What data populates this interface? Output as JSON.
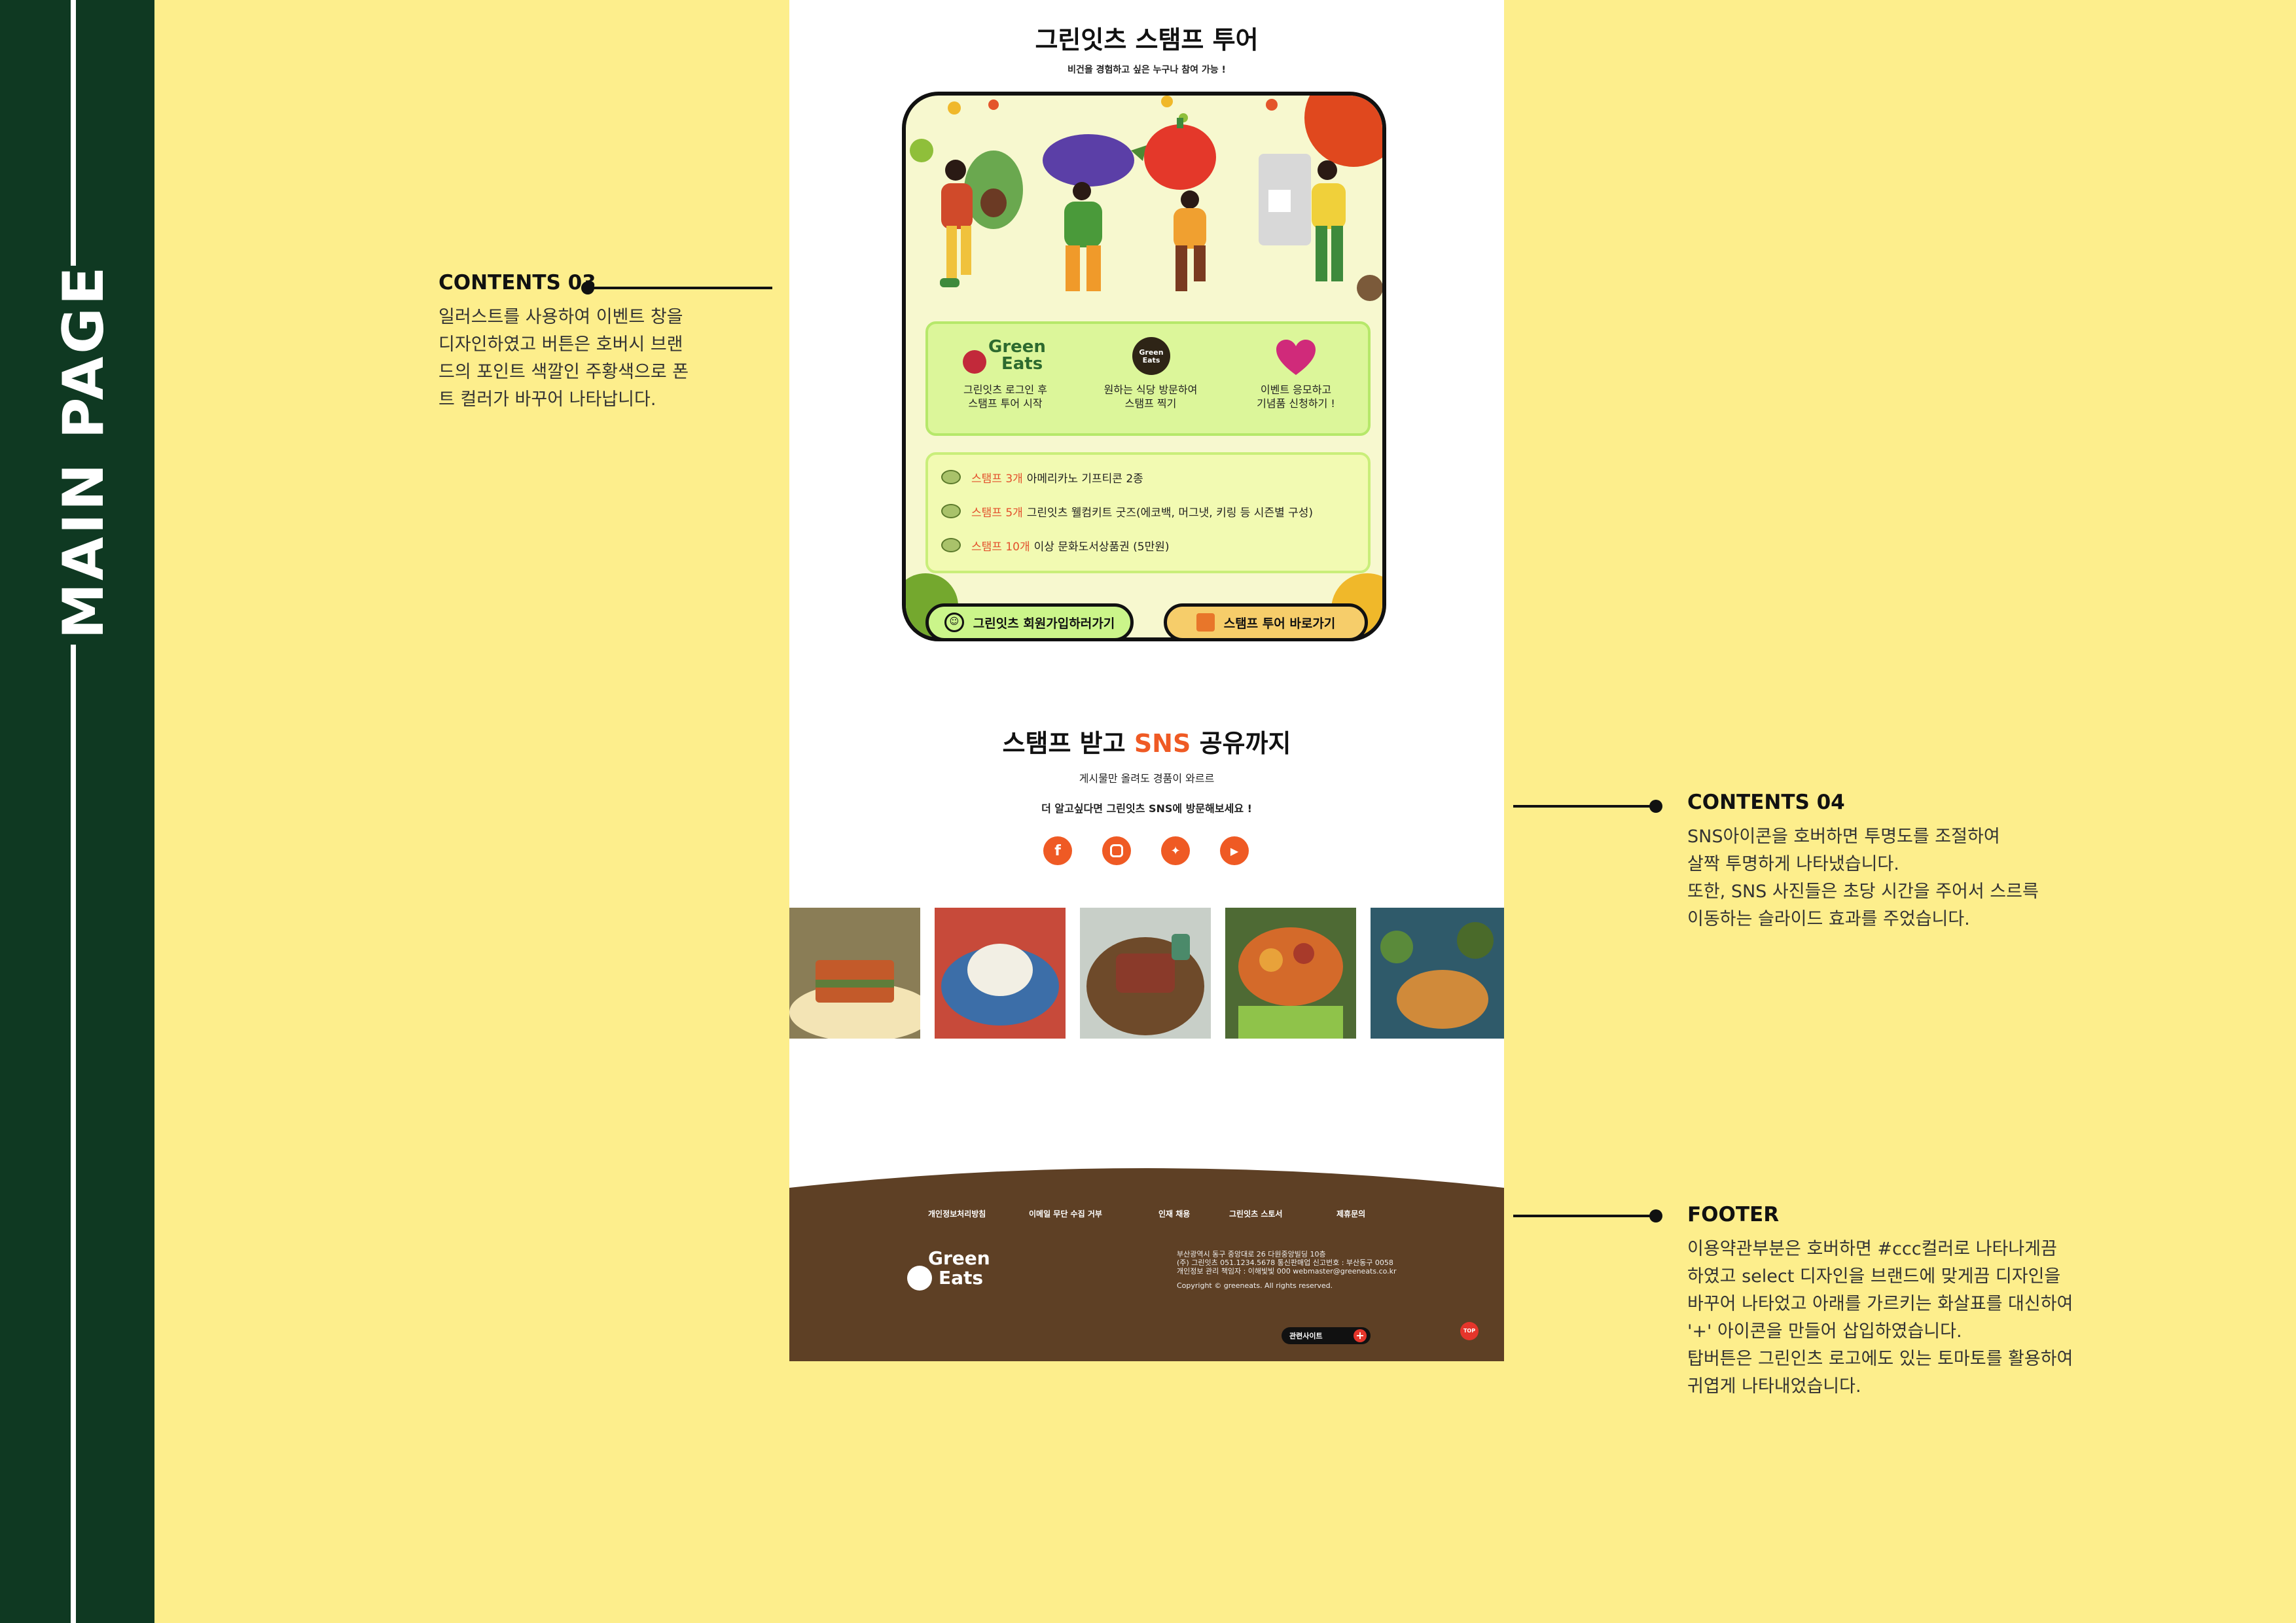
{
  "sidebar": {
    "title": "MAIN PAGE"
  },
  "annotations": {
    "contents03": {
      "title": "CONTENTS 03",
      "lines": [
        "일러스트를 사용하여 이벤트 창을",
        "디자인하였고 버튼은 호버시 브랜",
        "드의 포인트 색깔인 주황색으로 폰",
        "트 컬러가 바꾸어 나타납니다."
      ]
    },
    "contents04": {
      "title": "CONTENTS 04",
      "lines": [
        "SNS아이콘을 호버하면 투명도를 조절하여",
        "살짝 투명하게 나타냈습니다.",
        "또한, SNS 사진들은 초당 시간을 주어서 스르륵",
        "이동하는 슬라이드 효과를 주었습니다."
      ]
    },
    "footer": {
      "title": "FOOTER",
      "lines": [
        "이용약관부분은 호버하면 #ccc컬러로 나타나게끔",
        "하였고 select 디자인을 브랜드에 맞게끔 디자인을",
        "바꾸어 나타었고 아래를 가르키는 화살표를 대신하여",
        "'+' 아이콘을 만들어 삽입하였습니다.",
        "탑버튼은 그린인츠 로고에도 있는 토마토를 활용하여",
        "귀엽게 나타내었습니다."
      ]
    }
  },
  "stamp_tour": {
    "title": "그린잇츠 스탬프 투어",
    "subtitle": "비건을 경험하고 싶은 누구나 참여 가능 !",
    "steps": [
      {
        "icon": "green-eats-logo",
        "logo_text_1": "Green",
        "logo_text_2": "Eats",
        "label_1": "그린잇츠 로그인 후",
        "label_2": "스탬프 투어 시작"
      },
      {
        "icon": "stamp-icon",
        "stamp_text_1": "Green",
        "stamp_text_2": "Eats",
        "label_1": "원하는 식당 방문하여",
        "label_2": "스탬프 찍기"
      },
      {
        "icon": "heart-icon",
        "label_1": "이벤트 응모하고",
        "label_2": "기념품 신청하기 !"
      }
    ],
    "rewards": [
      {
        "highlight": "스탬프 3개",
        "text": "아메리카노 기프티콘 2종"
      },
      {
        "highlight": "스탬프 5개",
        "text": "그린잇츠 웰컴키트 굿즈(에코백, 머그냇, 키링 등 시즌별 구성)"
      },
      {
        "highlight": "스탬프 10개",
        "text": "이상 문화도서상품권 (5만원)"
      }
    ],
    "join_button": "그린잇츠 회원가입하러가기",
    "tour_button": "스탬프 투어 바로가기",
    "colors": {
      "card_bg": "#f7f8cf",
      "steps_bg": "#dcf69a",
      "join_bg": "#cbf58a",
      "tour_bg": "#f6cd6a"
    }
  },
  "sns": {
    "title_pre": "스탬프 받고 ",
    "title_accent": "SNS",
    "title_post": " 공유까지",
    "line1": "게시물만 올려도 경품이 와르르",
    "line2": "더 알고싶다면 그린잇츠 SNS에 방문해보세요 !",
    "icons": [
      "facebook-icon",
      "instagram-icon",
      "twitter-icon",
      "youtube-icon"
    ],
    "accent_color": "#ef5a24",
    "photos": [
      "vegan-sandwich-photo",
      "rice-platter-photo",
      "sandwich-plate-photo",
      "salad-bowl-photo",
      "pancake-table-photo"
    ]
  },
  "footer": {
    "links": [
      "개인정보처리방침",
      "이메일 무단 수집 거부",
      "인재 채용",
      "그린잇츠 스토서",
      "제휴문의"
    ],
    "logo_1": "Green",
    "logo_2": "Eats",
    "info_1": "부산광역시 동구 중앙대로 26 다원중앙빌딩 10층",
    "info_2": "(주) 그린잇츠 051.1234.5678 통신판매업 신고번호 : 부산동구 0058",
    "info_3": "개인정보 관리 책임자 : 이해빛빛 000 webmaster@greeneats.co.kr",
    "copyright": "Copyright © greeneats. All rights reserved.",
    "related": "관련사이트",
    "top": "TOP",
    "bg_color": "#5e4025"
  }
}
